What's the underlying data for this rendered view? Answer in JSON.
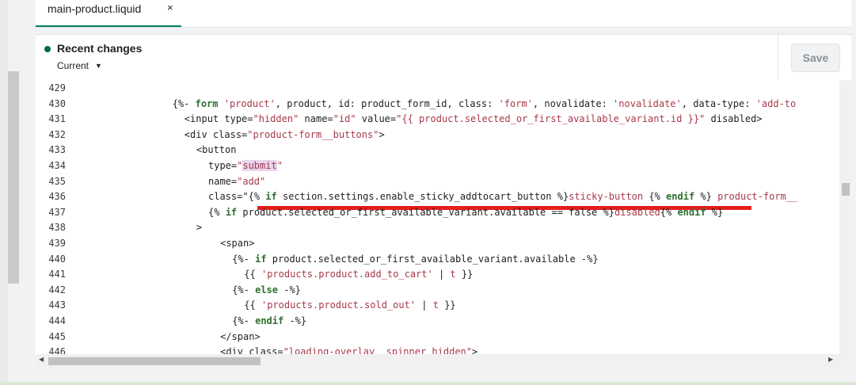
{
  "tab": {
    "name": "main-product.liquid",
    "close": "×"
  },
  "header": {
    "recent_label": "Recent changes",
    "current_label": "Current",
    "save_label": "Save"
  },
  "colors": {
    "accent": "#008060",
    "string": "#a8394a",
    "keyword": "#2f6e2f",
    "underline": "#e41e1e"
  },
  "code_lines": [
    {
      "n": "429",
      "indent": 0,
      "segs": []
    },
    {
      "n": "430",
      "indent": 14,
      "segs": [
        {
          "t": "{%- "
        },
        {
          "t": "form",
          "c": "kw"
        },
        {
          "t": " "
        },
        {
          "t": "'product'",
          "c": "str"
        },
        {
          "t": ", product, id: product_form_id, class: "
        },
        {
          "t": "'form'",
          "c": "str"
        },
        {
          "t": ", novalidate: "
        },
        {
          "t": "'novalidate'",
          "c": "str"
        },
        {
          "t": ", data-type: "
        },
        {
          "t": "'add-to",
          "c": "str"
        }
      ]
    },
    {
      "n": "431",
      "indent": 16,
      "segs": [
        {
          "t": "<input type="
        },
        {
          "t": "\"hidden\"",
          "c": "str"
        },
        {
          "t": " name="
        },
        {
          "t": "\"id\"",
          "c": "str"
        },
        {
          "t": " value="
        },
        {
          "t": "\"{{ product.selected_or_first_available_variant.id }}\"",
          "c": "str"
        },
        {
          "t": " disabled>"
        }
      ]
    },
    {
      "n": "432",
      "indent": 16,
      "segs": [
        {
          "t": "<div class="
        },
        {
          "t": "\"product-form__buttons\"",
          "c": "str"
        },
        {
          "t": ">"
        }
      ]
    },
    {
      "n": "433",
      "indent": 18,
      "segs": [
        {
          "t": "<button"
        }
      ]
    },
    {
      "n": "434",
      "indent": 20,
      "segs": [
        {
          "t": "type="
        },
        {
          "t": "\"",
          "c": "str"
        },
        {
          "t": "submit",
          "c": "str sel"
        },
        {
          "t": "\"",
          "c": "str"
        }
      ]
    },
    {
      "n": "435",
      "indent": 20,
      "segs": [
        {
          "t": "name="
        },
        {
          "t": "\"add\"",
          "c": "str"
        }
      ]
    },
    {
      "n": "436",
      "indent": 20,
      "segs": [
        {
          "t": "class="
        },
        {
          "t": "\""
        },
        {
          "t": "{% "
        },
        {
          "t": "if",
          "c": "kw"
        },
        {
          "t": " section.settings.enable_sticky_addtocart_button %}"
        },
        {
          "t": "sticky-button ",
          "c": "str"
        },
        {
          "t": "{% "
        },
        {
          "t": "endif",
          "c": "kw"
        },
        {
          "t": " %}"
        },
        {
          "t": " product-form__",
          "c": "str"
        }
      ]
    },
    {
      "n": "437",
      "indent": 20,
      "segs": [
        {
          "t": "{% "
        },
        {
          "t": "if",
          "c": "kw"
        },
        {
          "t": " product.selected_or_first_available_variant.available == false %}"
        },
        {
          "t": "disabled",
          "c": "str"
        },
        {
          "t": "{% "
        },
        {
          "t": "endif",
          "c": "kw"
        },
        {
          "t": " %}"
        }
      ]
    },
    {
      "n": "438",
      "indent": 18,
      "segs": [
        {
          "t": ">"
        }
      ]
    },
    {
      "n": "439",
      "indent": 22,
      "segs": [
        {
          "t": "<span>"
        }
      ]
    },
    {
      "n": "440",
      "indent": 24,
      "segs": [
        {
          "t": "{%- "
        },
        {
          "t": "if",
          "c": "kw"
        },
        {
          "t": " product.selected_or_first_available_variant.available -%}"
        }
      ]
    },
    {
      "n": "441",
      "indent": 26,
      "segs": [
        {
          "t": "{{ "
        },
        {
          "t": "'products.product.add_to_cart'",
          "c": "str"
        },
        {
          "t": " | "
        },
        {
          "t": "t",
          "c": "str"
        },
        {
          "t": " }}"
        }
      ]
    },
    {
      "n": "442",
      "indent": 24,
      "segs": [
        {
          "t": "{%- "
        },
        {
          "t": "else",
          "c": "kw"
        },
        {
          "t": " -%}"
        }
      ]
    },
    {
      "n": "443",
      "indent": 26,
      "segs": [
        {
          "t": "{{ "
        },
        {
          "t": "'products.product.sold_out'",
          "c": "str"
        },
        {
          "t": " | "
        },
        {
          "t": "t",
          "c": "str"
        },
        {
          "t": " }}"
        }
      ]
    },
    {
      "n": "444",
      "indent": 24,
      "segs": [
        {
          "t": "{%- "
        },
        {
          "t": "endif",
          "c": "kw"
        },
        {
          "t": " -%}"
        }
      ]
    },
    {
      "n": "445",
      "indent": 22,
      "segs": [
        {
          "t": "</span>"
        }
      ]
    },
    {
      "n": "446",
      "indent": 22,
      "segs": [
        {
          "t": "<div class="
        },
        {
          "t": "\"loading-overlay__spinner hidden\"",
          "c": "str"
        },
        {
          "t": ">"
        }
      ]
    }
  ]
}
